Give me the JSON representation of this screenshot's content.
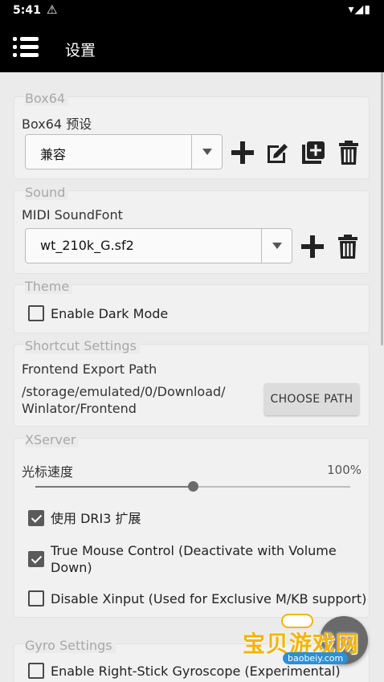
{
  "status_bar": {
    "time": "5:41",
    "warning_icon": "warning-triangle-icon",
    "right_icons": "▾◢▮"
  },
  "app_bar": {
    "title": "设置",
    "menu_icon": "hamburger-menu-icon"
  },
  "box64": {
    "section_title": "Box64",
    "preset_label": "Box64 预设",
    "preset_value": "兼容"
  },
  "sound": {
    "section_title": "Sound",
    "soundfont_label": "MIDI SoundFont",
    "soundfont_value": "wt_210k_G.sf2"
  },
  "theme": {
    "section_title": "Theme",
    "dark_mode_label": "Enable Dark Mode",
    "dark_mode_checked": false
  },
  "shortcut": {
    "section_title": "Shortcut Settings",
    "export_label": "Frontend Export Path",
    "export_path_line1": "/storage/emulated/0/Download/",
    "export_path_line2": "Winlator/Frontend",
    "choose_path_button": "CHOOSE PATH"
  },
  "xserver": {
    "section_title": "XServer",
    "cursor_speed_label": "光标速度",
    "cursor_speed_value": "100%",
    "cursor_speed_fraction": 0.5,
    "dri3_label": "使用 DRI3 扩展",
    "dri3_checked": true,
    "true_mouse_line1": "True Mouse Control (Deactivate with Volume",
    "true_mouse_line2": "Down)",
    "true_mouse_checked": true,
    "disable_xinput_label": "Disable Xinput (Used for Exclusive M/KB support)",
    "disable_xinput_checked": false
  },
  "gyro": {
    "section_title": "Gyro Settings",
    "right_stick_label": "Enable Right-Stick Gyroscope (Experimental)",
    "right_stick_checked": false
  },
  "watermark": {
    "text": "宝贝游戏网",
    "sub": "baobeiy.com"
  },
  "colors": {
    "appbar": "#000000",
    "background": "#ebebeb",
    "card": "#f1f1f1",
    "checkbox_checked": "#5a5a5a",
    "watermark": "#f4b400"
  }
}
